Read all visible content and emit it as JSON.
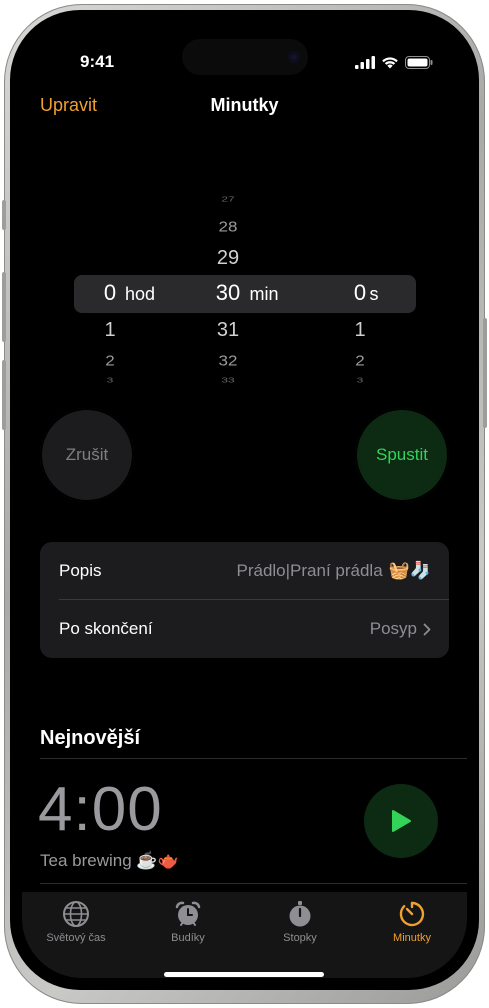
{
  "status": {
    "time": "9:41"
  },
  "nav": {
    "edit": "Upravit",
    "title": "Minutky"
  },
  "picker": {
    "hours": {
      "above": [
        "",
        ""
      ],
      "selected": "0",
      "unit": "hod",
      "below": [
        "1",
        "2",
        "3"
      ]
    },
    "minutes": {
      "above": [
        "27",
        "28",
        "29"
      ],
      "selected": "30",
      "unit": "min",
      "below": [
        "31",
        "32",
        "33"
      ]
    },
    "seconds": {
      "above": [
        "",
        ""
      ],
      "selected": "0",
      "unit": "s",
      "below": [
        "1",
        "2",
        "3"
      ]
    }
  },
  "buttons": {
    "cancel": "Zrušit",
    "start": "Spustit"
  },
  "settings": {
    "label_row": {
      "label": "Popis",
      "value": "Prádlo|Praní prádla",
      "emoji": "🧺🧦"
    },
    "when_done_row": {
      "label": "Po skončení",
      "value": "Posyp"
    }
  },
  "recent": {
    "title": "Nejnovější",
    "items": [
      {
        "time": "4:00",
        "label": "Tea brewing ☕🫖"
      }
    ]
  },
  "tabs": [
    {
      "label": "Světový čas",
      "icon": "globe-icon",
      "active": false
    },
    {
      "label": "Budíky",
      "icon": "alarm-clock-icon",
      "active": false
    },
    {
      "label": "Stopky",
      "icon": "stopwatch-icon",
      "active": false
    },
    {
      "label": "Minutky",
      "icon": "timer-icon",
      "active": true
    }
  ],
  "colors": {
    "accent": "#f0a030",
    "start_green": "#33d35a",
    "background": "#000000"
  }
}
